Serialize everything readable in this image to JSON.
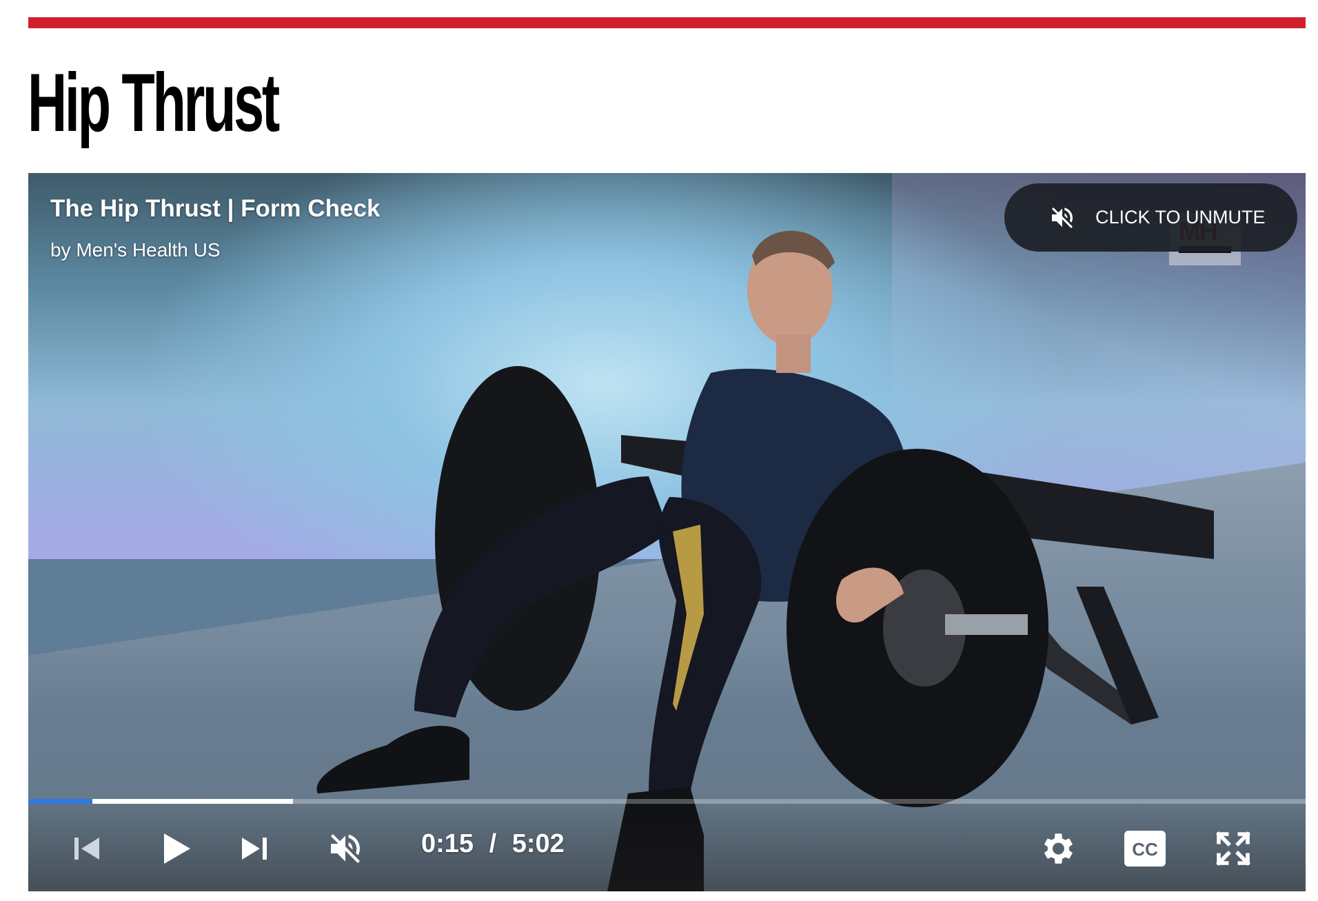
{
  "page": {
    "title": "Hip Thrust",
    "accent_color": "#d0202e"
  },
  "video": {
    "title": "The Hip Thrust | Form Check",
    "byline": "by Men's Health US",
    "unmute_label": "CLICK TO UNMUTE",
    "logo": "MH",
    "current_time": "0:15",
    "separator": "/",
    "duration": "5:02",
    "progress_played_fraction": 0.05,
    "progress_buffered_fraction": 0.207,
    "progress_color": "#2d7ae0",
    "icons": {
      "unmute": "muted-speaker-icon",
      "prev": "skip-previous-icon",
      "play": "play-icon",
      "next": "skip-next-icon",
      "volume": "muted-speaker-icon",
      "settings": "gear-icon",
      "captions": "cc-icon",
      "fullscreen": "fullscreen-icon"
    }
  }
}
